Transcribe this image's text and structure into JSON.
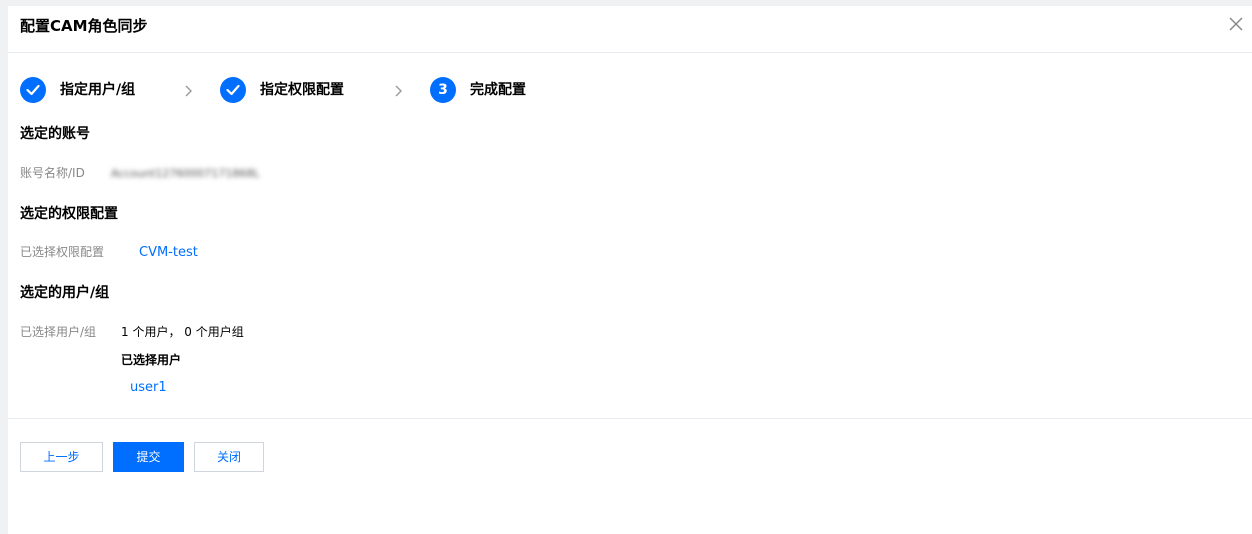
{
  "dialog": {
    "title": "配置CAM角色同步",
    "close_icon": "close-icon"
  },
  "steps": [
    {
      "label": "指定用户/组",
      "state": "done"
    },
    {
      "label": "指定权限配置",
      "state": "done"
    },
    {
      "label": "完成配置",
      "state": "current",
      "number": "3"
    }
  ],
  "account": {
    "section_title": "选定的账号",
    "label": "账号名称/ID",
    "value_blurred": "Account12760007171868L"
  },
  "permission": {
    "section_title": "选定的权限配置",
    "label": "已选择权限配置",
    "value": "CVM-test"
  },
  "users": {
    "section_title": "选定的用户/组",
    "label": "已选择用户/组",
    "summary": "1 个用户， 0 个用户组",
    "selected_users_title": "已选择用户",
    "selected_users": [
      "user1"
    ]
  },
  "footer": {
    "prev_label": "上一步",
    "submit_label": "提交",
    "close_label": "关闭"
  },
  "colors": {
    "primary": "#006eff",
    "border": "#cfd5de",
    "muted": "#888888"
  }
}
